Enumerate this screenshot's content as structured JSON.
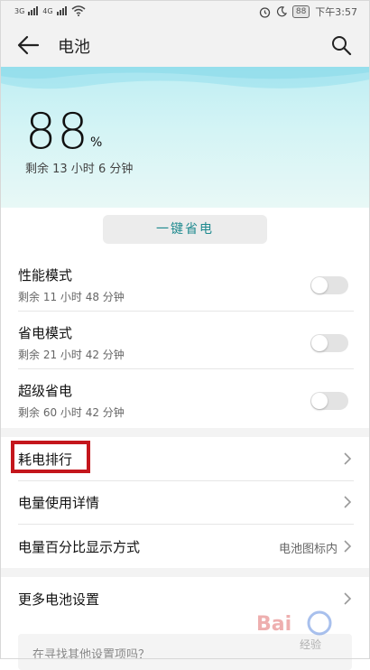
{
  "status_bar": {
    "signal1": "3G",
    "signal2": "4G",
    "battery": "88",
    "time": "下午3:57"
  },
  "app_bar": {
    "title": "电池"
  },
  "battery": {
    "percent": "88",
    "percent_sign": "%",
    "remaining": "剩余 13 小时 6 分钟"
  },
  "save_button": "一键省电",
  "modes": [
    {
      "title": "性能模式",
      "sub": "剩余 11 小时 48 分钟",
      "on": false
    },
    {
      "title": "省电模式",
      "sub": "剩余 21 小时 42 分钟",
      "on": false
    },
    {
      "title": "超级省电",
      "sub": "剩余 60 小时 42 分钟",
      "on": false
    }
  ],
  "rows": {
    "ranking": "耗电排行",
    "details": "电量使用详情",
    "percent_display": "电量百分比显示方式",
    "percent_display_value": "电池图标内",
    "more": "更多电池设置"
  },
  "suggestion": "在寻找其他设置项吗？",
  "watermark": "Bai 经验",
  "colors": {
    "accent": "#1f8a8f",
    "highlight": "#c4161c",
    "hero_top": "#bfeef4"
  }
}
